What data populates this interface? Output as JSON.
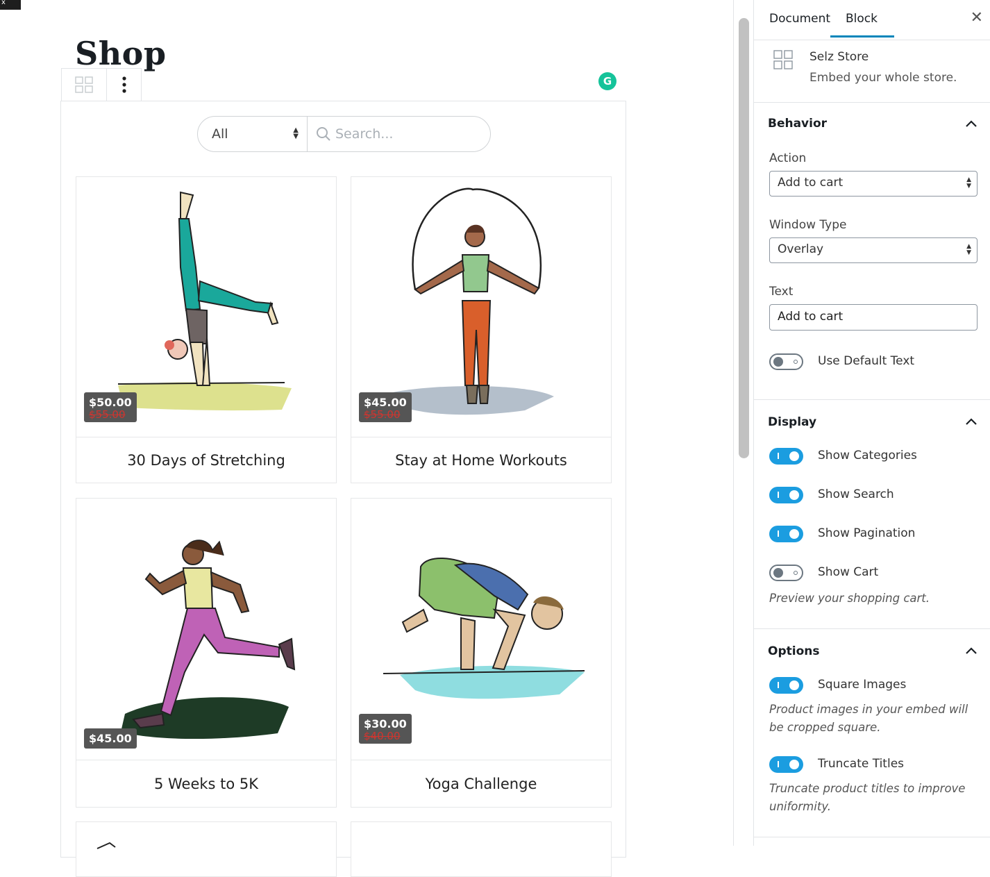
{
  "editor": {
    "page_title": "Shop",
    "grammarly_letter": "G"
  },
  "store": {
    "category_select": "All",
    "search_placeholder": "Search...",
    "products": [
      {
        "title": "30 Days of Stretching",
        "price": "$50.00",
        "old_price": "$55.00"
      },
      {
        "title": "Stay at Home Workouts",
        "price": "$45.00",
        "old_price": "$55.00"
      },
      {
        "title": "5 Weeks to 5K",
        "price": "$45.00",
        "old_price": ""
      },
      {
        "title": "Yoga Challenge",
        "price": "$30.00",
        "old_price": "$40.00"
      }
    ]
  },
  "sidebar": {
    "tabs": [
      "Document",
      "Block"
    ],
    "close_glyph": "✕",
    "block": {
      "name": "Selz Store",
      "description": "Embed your whole store."
    },
    "behavior": {
      "title": "Behavior",
      "action_label": "Action",
      "action_value": "Add to cart",
      "window_label": "Window Type",
      "window_value": "Overlay",
      "text_label": "Text",
      "text_value": "Add to cart",
      "default_text_label": "Use Default Text",
      "default_text_on": false
    },
    "display": {
      "title": "Display",
      "show_categories": "Show Categories",
      "show_search": "Show Search",
      "show_pagination": "Show Pagination",
      "show_cart": "Show Cart",
      "show_cart_help": "Preview your shopping cart."
    },
    "options": {
      "title": "Options",
      "square_images": "Square Images",
      "square_images_help": "Product images in your embed will be cropped square.",
      "truncate_titles": "Truncate Titles",
      "truncate_titles_help": "Truncate product titles to improve uniformity."
    }
  },
  "colors": {
    "accent": "#0085ba",
    "toggle_on": "#1b9de0",
    "price_badge": "#555555",
    "strike": "#d0352f",
    "grammarly": "#15c39a"
  }
}
